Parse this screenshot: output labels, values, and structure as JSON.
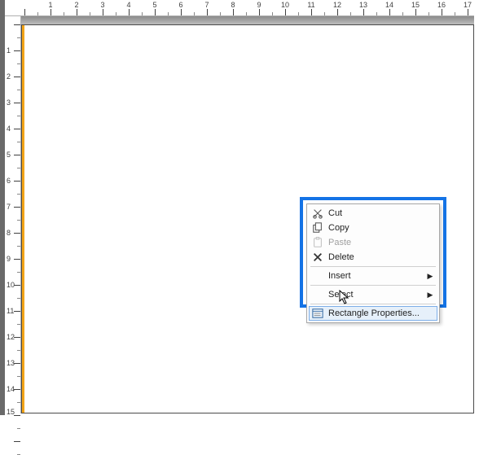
{
  "ruler": {
    "h_units": [
      1,
      2,
      3,
      4,
      5,
      6,
      7,
      8,
      9,
      10,
      11,
      12,
      13,
      14,
      15,
      16,
      17
    ],
    "v_units": [
      1,
      2,
      3,
      4,
      5,
      6,
      7,
      8,
      9,
      10,
      11,
      12,
      13,
      14,
      15
    ]
  },
  "context_menu": {
    "items": [
      {
        "icon": "cut-icon",
        "label": "Cut",
        "disabled": false,
        "submenu": false
      },
      {
        "icon": "copy-icon",
        "label": "Copy",
        "disabled": false,
        "submenu": false
      },
      {
        "icon": "paste-icon",
        "label": "Paste",
        "disabled": true,
        "submenu": false
      },
      {
        "icon": "delete-icon",
        "label": "Delete",
        "disabled": false,
        "submenu": false
      },
      {
        "icon": "",
        "label": "Insert",
        "disabled": false,
        "submenu": true
      },
      {
        "icon": "",
        "label": "Select",
        "disabled": false,
        "submenu": true
      },
      {
        "icon": "properties-icon",
        "label": "Rectangle Properties...",
        "disabled": false,
        "submenu": false,
        "hovered": true
      }
    ],
    "separators_after": [
      3,
      5
    ]
  },
  "colors": {
    "highlight": "#1473e6",
    "page_edge": "#f2a418"
  }
}
